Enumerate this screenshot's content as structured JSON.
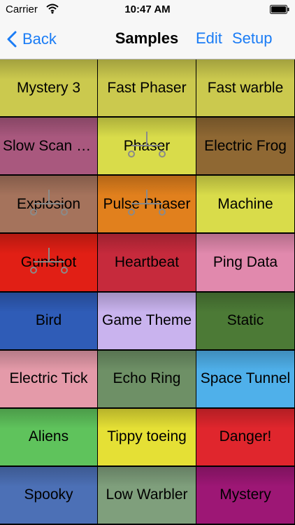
{
  "status_bar": {
    "carrier": "Carrier",
    "time": "10:47 AM"
  },
  "nav": {
    "back_label": "Back",
    "title": "Samples",
    "edit_label": "Edit",
    "setup_label": "Setup"
  },
  "accent_color": "#1a7cf5",
  "tiles": [
    {
      "label": "Mystery 3",
      "color": "#cbc94e",
      "marker": false
    },
    {
      "label": "Fast Phaser",
      "color": "#cbc94e",
      "marker": false
    },
    {
      "label": "Fast warble",
      "color": "#cbc94e",
      "marker": false
    },
    {
      "label": "Slow Scan Phaser",
      "color": "#a9587e",
      "marker": false
    },
    {
      "label": "Phaser",
      "color": "#d9dc4a",
      "marker": true
    },
    {
      "label": "Electric Frog",
      "color": "#8f6833",
      "marker": false
    },
    {
      "label": "Explosion",
      "color": "#a5735c",
      "marker": true
    },
    {
      "label": "Pulse Phaser",
      "color": "#e1801d",
      "marker": true
    },
    {
      "label": "Machine",
      "color": "#d9dc4a",
      "marker": false
    },
    {
      "label": "Gunshot",
      "color": "#e11f15",
      "marker": true
    },
    {
      "label": "Heartbeat",
      "color": "#c62a3c",
      "marker": false
    },
    {
      "label": "Ping Data",
      "color": "#e189ad",
      "marker": false
    },
    {
      "label": "Bird",
      "color": "#2f5cb7",
      "marker": false
    },
    {
      "label": "Game Theme",
      "color": "#c9b3ee",
      "marker": false
    },
    {
      "label": "Static",
      "color": "#4c7a36",
      "marker": false
    },
    {
      "label": "Electric Tick",
      "color": "#e49aa9",
      "marker": false
    },
    {
      "label": "Echo Ring",
      "color": "#6e9066",
      "marker": false
    },
    {
      "label": "Space Tunnel",
      "color": "#4fb0ea",
      "marker": false
    },
    {
      "label": "Aliens",
      "color": "#5fc35c",
      "marker": false
    },
    {
      "label": "Tippy toeing",
      "color": "#e5e035",
      "marker": false
    },
    {
      "label": "Danger!",
      "color": "#e0262d",
      "marker": false
    },
    {
      "label": "Spooky",
      "color": "#4c70b6",
      "marker": false
    },
    {
      "label": "Low Warbler",
      "color": "#7f9f7c",
      "marker": false
    },
    {
      "label": "Mystery",
      "color": "#9d1775",
      "marker": false
    }
  ]
}
